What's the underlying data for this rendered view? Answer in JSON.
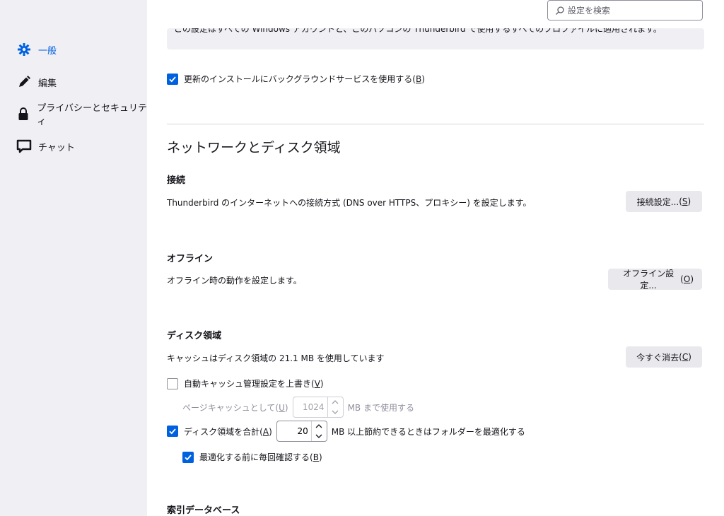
{
  "sidebar": {
    "items": [
      {
        "label": "一般",
        "icon": "gear-icon",
        "active": true
      },
      {
        "label": "編集",
        "icon": "pen-icon",
        "active": false
      },
      {
        "label": "プライバシーとセキュリティ",
        "icon": "lock-icon",
        "active": false
      },
      {
        "label": "チャット",
        "icon": "chat-icon",
        "active": false
      }
    ]
  },
  "search": {
    "placeholder": "設定を検索"
  },
  "clipped_note": "この設定はすべての Windows アカウントと、このパソコンの Thunderbird で使用するすべてのプロファイルに適用されます。",
  "update": {
    "background_service": {
      "label": "更新のインストールにバックグラウンドサービスを使用する",
      "accesskey": "B",
      "checked": true
    }
  },
  "network": {
    "heading": "ネットワークとディスク領域",
    "connection": {
      "title": "接続",
      "description": "Thunderbird のインターネットへの接続方式 (DNS over HTTPS、プロキシー) を設定します。",
      "button_label": "接続設定...",
      "button_key": "S"
    },
    "offline": {
      "title": "オフライン",
      "description": "オフライン時の動作を設定します。",
      "button_label": "オフライン設定...",
      "button_key": "O"
    },
    "disk": {
      "title": "ディスク領域",
      "usage_text": "キャッシュはディスク領域の 21.1 MB を使用しています",
      "clear_label": "今すぐ消去",
      "clear_key": "C",
      "override_label": "自動キャッシュ管理設定を上書き",
      "override_key": "V",
      "override_checked": false,
      "cache_prefix": "ページキャッシュとして",
      "cache_key": "U",
      "cache_value": "1024",
      "cache_suffix": "MB まで使用する",
      "compact_label": "ディスク領域を合計",
      "compact_key": "A",
      "compact_checked": true,
      "compact_value": "20",
      "compact_suffix": "MB 以上節約できるときはフォルダーを最適化する",
      "confirm_label": "最適化する前に毎回確認する",
      "confirm_key": "B",
      "confirm_checked": true
    },
    "index": {
      "title": "索引データベース"
    }
  },
  "colors": {
    "accent": "#0061e0",
    "sidebar_bg": "#f0f0f4",
    "button_bg": "#e9e9ed"
  }
}
